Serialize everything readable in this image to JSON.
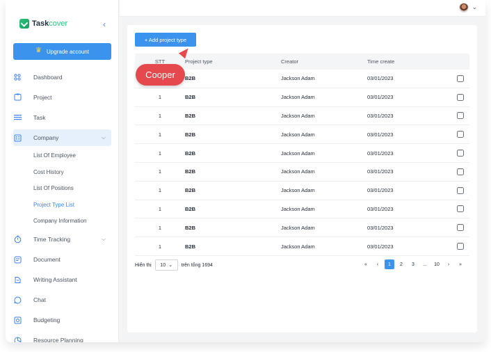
{
  "app": {
    "brand_a": "Task",
    "brand_b": "cover",
    "collapse_icon": "chevron-left-icon"
  },
  "upgrade": {
    "label": "Upgrade account"
  },
  "nav": [
    {
      "label": "Dashboard",
      "icon": "grid-icon"
    },
    {
      "label": "Project",
      "icon": "project-icon"
    },
    {
      "label": "Task",
      "icon": "list-icon"
    },
    {
      "label": "Company",
      "icon": "building-icon",
      "expanded": true,
      "children": [
        "List Of Employee",
        "Cost History",
        "List Of Positions",
        "Project Type List",
        "Company Information"
      ],
      "active_child": "Project Type List"
    },
    {
      "label": "Time Tracking",
      "icon": "stopwatch-icon",
      "has_chevron": true
    },
    {
      "label": "Document",
      "icon": "document-icon"
    },
    {
      "label": "Writing Assistant",
      "icon": "writing-icon"
    },
    {
      "label": "Chat",
      "icon": "chat-icon"
    },
    {
      "label": "Budgeting",
      "icon": "budget-icon"
    },
    {
      "label": "Resource Planning",
      "icon": "resource-icon"
    }
  ],
  "toolbar": {
    "add_label": "+ Add project type"
  },
  "table": {
    "headers": [
      "STT",
      "Project type",
      "Creator",
      "Time create",
      ""
    ],
    "rows": [
      [
        "1",
        "B2B",
        "Jackson Adam",
        "03/01/2023"
      ],
      [
        "1",
        "B2B",
        "Jackson Adam",
        "03/01/2023"
      ],
      [
        "1",
        "B2B",
        "Jackson Adam",
        "03/01/2023"
      ],
      [
        "1",
        "B2B",
        "Jackson Adam",
        "03/01/2023"
      ],
      [
        "1",
        "B2B",
        "Jackson Adam",
        "03/01/2023"
      ],
      [
        "1",
        "B2B",
        "Jackson Adam",
        "03/01/2023"
      ],
      [
        "1",
        "B2B",
        "Jackson Adam",
        "03/01/2023"
      ],
      [
        "1",
        "B2B",
        "Jackson Adam",
        "03/01/2023"
      ],
      [
        "1",
        "B2B",
        "Jackson Adam",
        "03/01/2023"
      ],
      [
        "1",
        "B2B",
        "Jackson Adam",
        "03/01/2023"
      ]
    ]
  },
  "pagination": {
    "show_label": "Hiển thị",
    "page_size": "10",
    "total_label": "trên tổng 1694",
    "pages": [
      "«",
      "‹",
      "1",
      "2",
      "3",
      "...",
      "10",
      "›",
      "»"
    ],
    "current": "1"
  },
  "annotation": {
    "label": "Cooper"
  },
  "colors": {
    "accent": "#3b93ee",
    "annotation": "#e5484d",
    "brand_green": "#2ec27e"
  }
}
